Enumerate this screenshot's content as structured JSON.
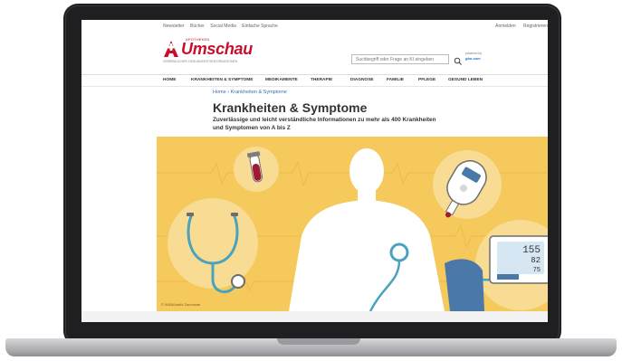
{
  "topbar": {
    "left": [
      "Newsletter",
      "Bücher",
      "Social Media",
      "Einfache Sprache"
    ],
    "right": [
      "Anmelden",
      "Registrieren"
    ]
  },
  "logo": {
    "name": "Umschau",
    "small": "APOTHEKEN",
    "tagline": "VERBRAUCHER-GESUNDHEITSINFORMATIONEN"
  },
  "search": {
    "placeholder": "Suchbegriff oder Frage an KI eingeben",
    "powered_by": "powered by",
    "powered_brand": "gbo.com"
  },
  "nav": [
    "HOME",
    "KRANKHEITEN & SYMPTOME",
    "MEDIKAMENTE",
    "THERAPIE",
    "DIAGNOSE",
    "FAMILIE",
    "PFLEGE",
    "GESUND LEBEN"
  ],
  "breadcrumb": {
    "home": "Home",
    "separator": "›",
    "current": "Krankheiten & Symptome"
  },
  "title": "Krankheiten & Symptome",
  "intro": "Zuverlässige und leicht verständliche Informationen zu mehr als 400 Krankheiten und Symptomen von A bis Z",
  "hero": {
    "caption": "© W&B/Astrid Zacharias",
    "monitor": {
      "sys": "155",
      "dia": "82",
      "pulse": "75"
    }
  },
  "colors": {
    "brand": "#c8102e",
    "hero_bg": "#f5c95b",
    "link": "#3c6cb3",
    "accent_teal": "#4aa3bd"
  }
}
